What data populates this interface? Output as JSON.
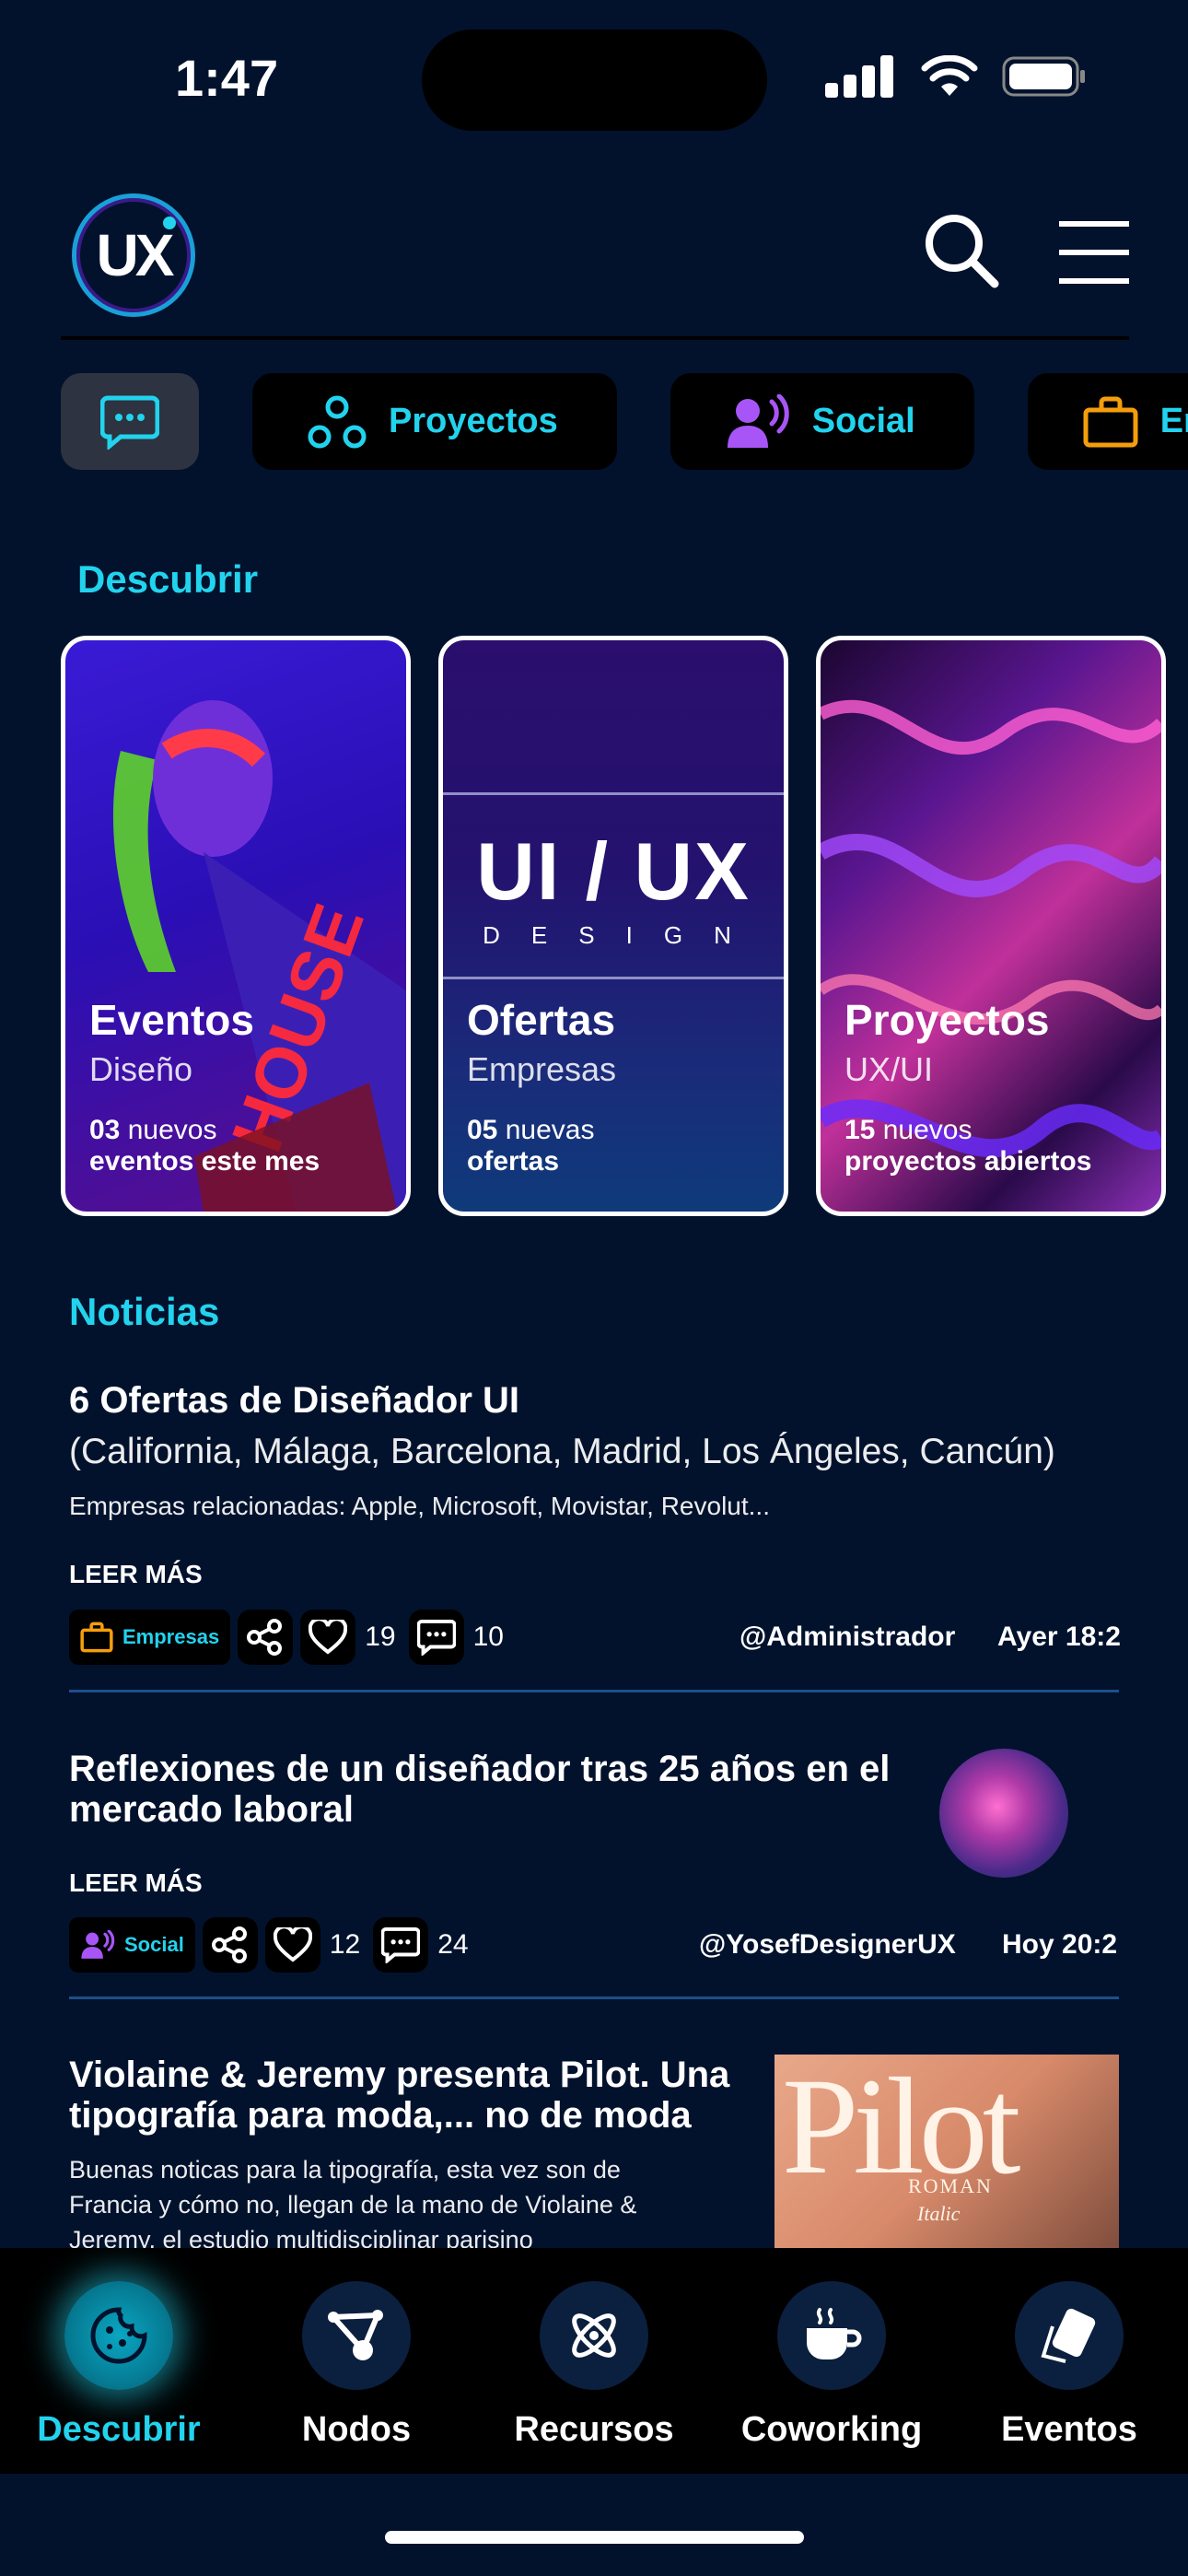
{
  "status_bar": {
    "time": "1:47"
  },
  "header": {
    "logo_text": "UX"
  },
  "chips": [
    {
      "label": "Proyectos",
      "icon": "nodes-icon"
    },
    {
      "label": "Social",
      "icon": "speaking-user-icon"
    },
    {
      "label": "Empre",
      "icon": "briefcase-icon"
    }
  ],
  "discover": {
    "title": "Descubrir",
    "cards": [
      {
        "title": "Eventos",
        "subtitle": "Diseño",
        "count": "03",
        "count_text": " nuevos",
        "line2": "eventos este mes"
      },
      {
        "title": "Ofertas",
        "subtitle": "Empresas",
        "count": "05",
        "count_text": " nuevas",
        "line2": "ofertas",
        "art_title": "UI / UX",
        "art_sub": "DESIGN"
      },
      {
        "title": "Proyectos",
        "subtitle": "UX/UI",
        "count": "15",
        "count_text": " nuevos",
        "line2": "proyectos abiertos"
      }
    ]
  },
  "news": {
    "title": "Noticias",
    "read_more": "LEER MÁS",
    "items": [
      {
        "title": "6 Ofertas de Diseñador UI",
        "subtitle": "(California, Málaga, Barcelona, Madrid, Los Ángeles, Cancún)",
        "desc": "Empresas relacionadas: Apple, Microsoft, Movistar, Revolut...",
        "tag": "Empresas",
        "likes": "19",
        "comments": "10",
        "author": "@Administrador",
        "date": "Ayer 18:2"
      },
      {
        "title": "Reflexiones de un diseñador tras 25 años en el mercado laboral",
        "tag": "Social",
        "likes": "12",
        "comments": "24",
        "author": "@YosefDesignerUX",
        "date": "Hoy 20:2"
      },
      {
        "title": "Violaine & Jeremy presenta Pilot. Una tipografía para moda,... no de moda",
        "desc": "Buenas noticas para la tipografía, esta vez son de Francia y cómo no, llegan de la mano de Violaine & Jeremy, el estudio multidisciplinar parisino",
        "thumb_title": "Pilot",
        "thumb_sub1": "ROMAN",
        "thumb_sub2": "Italic"
      }
    ]
  },
  "tabbar": [
    {
      "label": "Descubrir",
      "icon": "cookie-icon",
      "active": true
    },
    {
      "label": "Nodos",
      "icon": "network-icon"
    },
    {
      "label": "Recursos",
      "icon": "atom-icon"
    },
    {
      "label": "Coworking",
      "icon": "coffee-icon"
    },
    {
      "label": "Eventos",
      "icon": "ticket-icon"
    }
  ],
  "colors": {
    "accent": "#22d3ee",
    "background": "#02122d",
    "purple": "#a855f7",
    "orange": "#f59e0b"
  }
}
